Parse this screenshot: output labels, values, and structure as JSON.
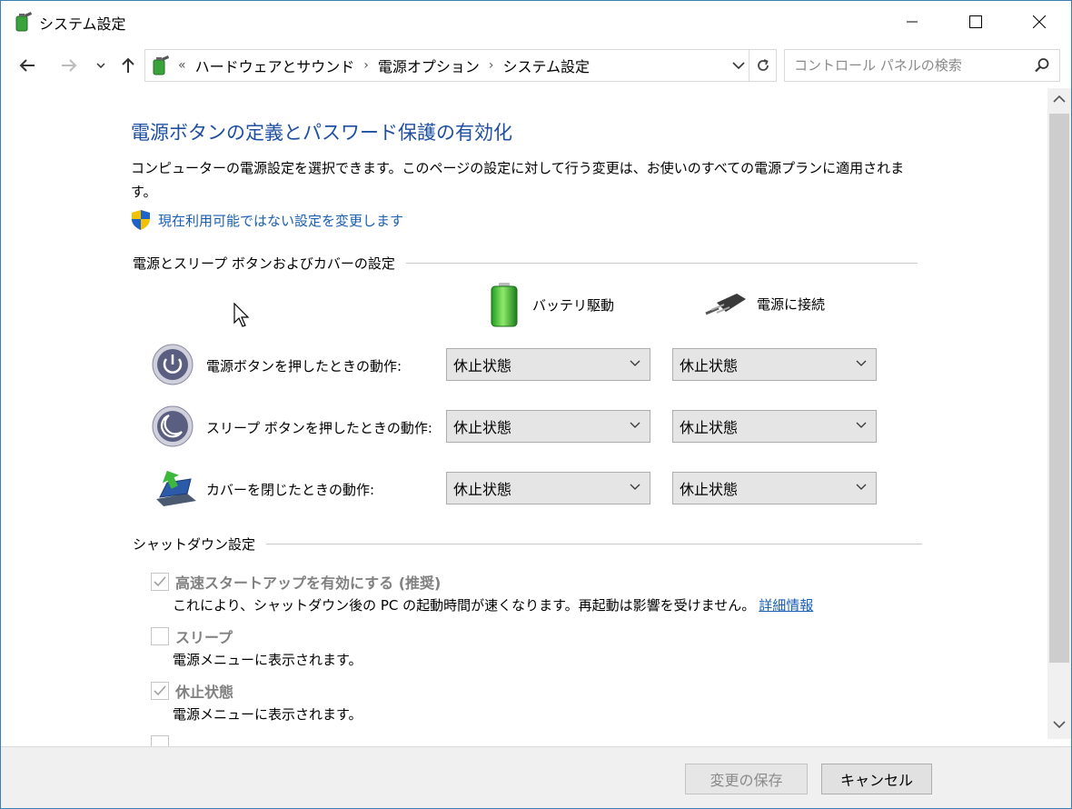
{
  "window": {
    "title": "システム設定",
    "icon": "power-options-icon"
  },
  "nav": {
    "breadcrumb_prefix": "«",
    "breadcrumbs": [
      "ハードウェアとサウンド",
      "電源オプション",
      "システム設定"
    ],
    "search_placeholder": "コントロール パネルの検索"
  },
  "page": {
    "heading": "電源ボタンの定義とパスワード保護の有効化",
    "description": "コンピューターの電源設定を選択できます。このページの設定に対して行う変更は、お使いのすべての電源プランに適用されます。",
    "change_link": "現在利用可能ではない設定を変更します"
  },
  "buttons_section": {
    "title": "電源とスリープ ボタンおよびカバーの設定",
    "columns": {
      "battery": "バッテリ駆動",
      "plugged": "電源に接続"
    },
    "rows": [
      {
        "label": "電源ボタンを押したときの動作:",
        "battery": "休止状態",
        "plugged": "休止状態",
        "icon": "power-button-icon"
      },
      {
        "label": "スリープ ボタンを押したときの動作:",
        "battery": "休止状態",
        "plugged": "休止状態",
        "icon": "sleep-button-icon"
      },
      {
        "label": "カバーを閉じたときの動作:",
        "battery": "休止状態",
        "plugged": "休止状態",
        "icon": "lid-close-icon"
      }
    ]
  },
  "shutdown_section": {
    "title": "シャットダウン設定",
    "items": [
      {
        "label": "高速スタートアップを有効にする (推奨)",
        "checked": true,
        "desc": "これにより、シャットダウン後の PC の起動時間が速くなります。再起動は影響を受けません。",
        "more": "詳細情報"
      },
      {
        "label": "スリープ",
        "checked": false,
        "desc": "電源メニューに表示されます。"
      },
      {
        "label": "休止状態",
        "checked": true,
        "desc": "電源メニューに表示されます。"
      }
    ]
  },
  "footer": {
    "save": "変更の保存",
    "cancel": "キャンセル"
  },
  "colors": {
    "heading": "#1e4fa0",
    "link": "#1a5fb4",
    "window_border": "#3c7fb1"
  }
}
